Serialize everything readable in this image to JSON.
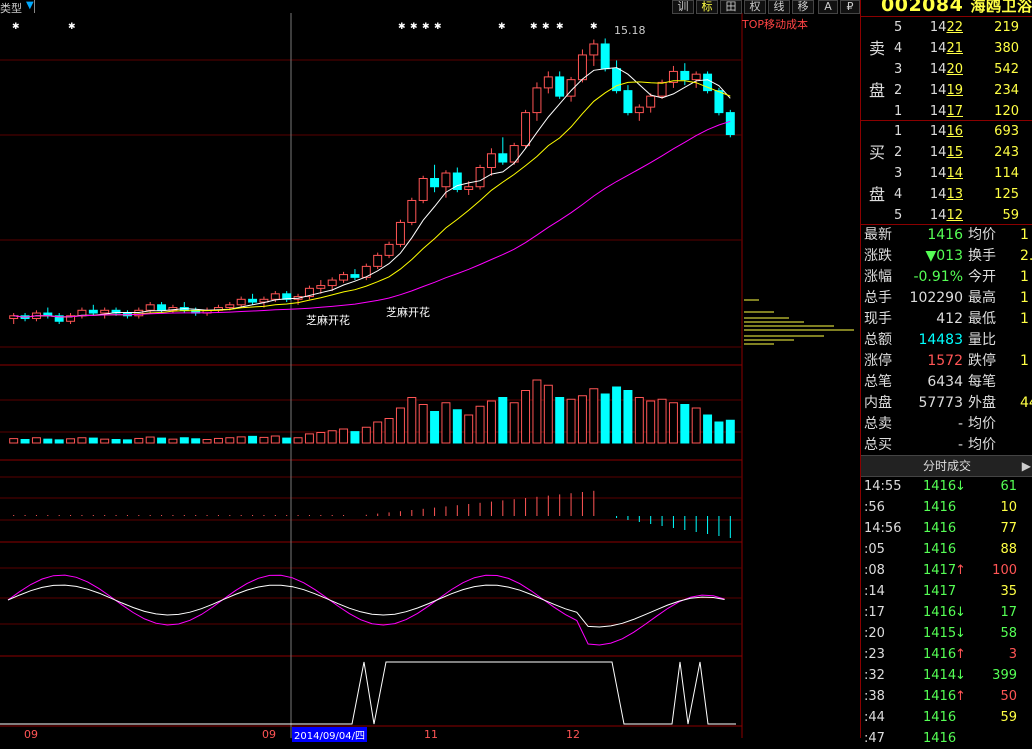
{
  "toolbar": {
    "left_label": "类型",
    "buttons": [
      "训",
      "标",
      "田",
      "权",
      "线",
      "移",
      "A",
      "₽",
      "▶"
    ]
  },
  "stock": {
    "code": "002084",
    "name": "海鸥卫浴"
  },
  "chart_annotations": {
    "peak_label": "15.18",
    "zhima_1": "芝麻开花",
    "zhima_2": "芝麻开花",
    "top_tool_label": "TOP移动成本"
  },
  "bottom_axis": {
    "left_tick": "09",
    "mid_tick": "09",
    "date_box": "2014/09/04/四",
    "tick_11": "11",
    "tick_12": "12"
  },
  "order_book": {
    "sell_label_1": "卖",
    "sell_label_2": "盘",
    "buy_label_1": "买",
    "buy_label_2": "盘",
    "sell": [
      {
        "level": "5",
        "price": "1422",
        "volume": "219"
      },
      {
        "level": "4",
        "price": "1421",
        "volume": "380"
      },
      {
        "level": "3",
        "price": "1420",
        "volume": "542"
      },
      {
        "level": "2",
        "price": "1419",
        "volume": "234"
      },
      {
        "level": "1",
        "price": "1417",
        "volume": "120"
      }
    ],
    "buy": [
      {
        "level": "1",
        "price": "1416",
        "volume": "693"
      },
      {
        "level": "2",
        "price": "1415",
        "volume": "243"
      },
      {
        "level": "3",
        "price": "1414",
        "volume": "114"
      },
      {
        "level": "4",
        "price": "1413",
        "volume": "125"
      },
      {
        "level": "5",
        "price": "1412",
        "volume": "59"
      }
    ]
  },
  "quote": [
    {
      "k1": "最新",
      "v1": "1416",
      "k2": "均价",
      "v2": "1"
    },
    {
      "k1": "涨跌",
      "v1": "▼013",
      "k2": "换手",
      "v2": "2."
    },
    {
      "k1": "涨幅",
      "v1": "-0.91%",
      "k2": "今开",
      "v2": "1"
    },
    {
      "k1": "总手",
      "v1": "102290",
      "k2": "最高",
      "v2": "1"
    },
    {
      "k1": "现手",
      "v1": "412",
      "k2": "最低",
      "v2": "1"
    },
    {
      "k1": "总额",
      "v1": "14483",
      "k2": "量比",
      "v2": ""
    },
    {
      "k1": "涨停",
      "v1": "1572",
      "k2": "跌停",
      "v2": "1"
    },
    {
      "k1": "总笔",
      "v1": "6434",
      "k2": "每笔",
      "v2": ""
    },
    {
      "k1": "内盘",
      "v1": "57773",
      "k2": "外盘",
      "v2": "44"
    },
    {
      "k1": "总卖",
      "v1": "-",
      "k2": "均价",
      "v2": ""
    },
    {
      "k1": "总买",
      "v1": "-",
      "k2": "均价",
      "v2": ""
    }
  ],
  "ticks_title": "分时成交",
  "ticks": [
    {
      "time": "14:55",
      "price": "1416",
      "arrow": "↓",
      "vol": "61"
    },
    {
      "time": ":56",
      "price": "1416",
      "arrow": "",
      "vol": "10"
    },
    {
      "time": "14:56",
      "price": "1416",
      "arrow": "",
      "vol": "77"
    },
    {
      "time": ":05",
      "price": "1416",
      "arrow": "",
      "vol": "88"
    },
    {
      "time": ":08",
      "price": "1417",
      "arrow": "↑",
      "vol": "100"
    },
    {
      "time": ":14",
      "price": "1417",
      "arrow": "",
      "vol": "35"
    },
    {
      "time": ":17",
      "price": "1416",
      "arrow": "↓",
      "vol": "17"
    },
    {
      "time": ":20",
      "price": "1415",
      "arrow": "↓",
      "vol": "58"
    },
    {
      "time": ":23",
      "price": "1416",
      "arrow": "↑",
      "vol": "3"
    },
    {
      "time": ":32",
      "price": "1414",
      "arrow": "↓",
      "vol": "399"
    },
    {
      "time": ":38",
      "price": "1416",
      "arrow": "↑",
      "vol": "50"
    },
    {
      "time": ":44",
      "price": "1416",
      "arrow": "",
      "vol": "59"
    },
    {
      "time": ":47",
      "price": "1416",
      "arrow": "",
      "vol": ""
    }
  ],
  "chart_data": {
    "type": "candlestick",
    "candles": [
      [
        10.1,
        10.2,
        10.0,
        10.15
      ],
      [
        10.15,
        10.2,
        10.05,
        10.1
      ],
      [
        10.1,
        10.25,
        10.05,
        10.2
      ],
      [
        10.2,
        10.3,
        10.1,
        10.15
      ],
      [
        10.15,
        10.2,
        10.0,
        10.05
      ],
      [
        10.05,
        10.2,
        10.0,
        10.15
      ],
      [
        10.15,
        10.3,
        10.1,
        10.25
      ],
      [
        10.25,
        10.35,
        10.15,
        10.2
      ],
      [
        10.2,
        10.3,
        10.1,
        10.25
      ],
      [
        10.25,
        10.3,
        10.15,
        10.2
      ],
      [
        10.2,
        10.25,
        10.1,
        10.15
      ],
      [
        10.15,
        10.3,
        10.1,
        10.25
      ],
      [
        10.25,
        10.4,
        10.2,
        10.35
      ],
      [
        10.35,
        10.4,
        10.2,
        10.25
      ],
      [
        10.25,
        10.35,
        10.2,
        10.3
      ],
      [
        10.3,
        10.4,
        10.2,
        10.25
      ],
      [
        10.25,
        10.3,
        10.15,
        10.2
      ],
      [
        10.2,
        10.3,
        10.15,
        10.25
      ],
      [
        10.25,
        10.35,
        10.2,
        10.3
      ],
      [
        10.3,
        10.4,
        10.25,
        10.35
      ],
      [
        10.35,
        10.5,
        10.3,
        10.45
      ],
      [
        10.45,
        10.55,
        10.35,
        10.4
      ],
      [
        10.4,
        10.5,
        10.3,
        10.45
      ],
      [
        10.45,
        10.6,
        10.4,
        10.55
      ],
      [
        10.55,
        10.6,
        10.4,
        10.45
      ],
      [
        10.45,
        10.55,
        10.35,
        10.5
      ],
      [
        10.5,
        10.7,
        10.45,
        10.65
      ],
      [
        10.65,
        10.8,
        10.55,
        10.7
      ],
      [
        10.7,
        10.85,
        10.6,
        10.8
      ],
      [
        10.8,
        10.95,
        10.75,
        10.9
      ],
      [
        10.9,
        11.0,
        10.8,
        10.85
      ],
      [
        10.85,
        11.1,
        10.8,
        11.05
      ],
      [
        11.05,
        11.3,
        11.0,
        11.25
      ],
      [
        11.25,
        11.5,
        11.2,
        11.45
      ],
      [
        11.45,
        11.9,
        11.4,
        11.85
      ],
      [
        11.85,
        12.3,
        11.8,
        12.25
      ],
      [
        12.25,
        12.7,
        12.2,
        12.65
      ],
      [
        12.65,
        12.9,
        12.4,
        12.5
      ],
      [
        12.5,
        12.8,
        12.3,
        12.75
      ],
      [
        12.75,
        12.85,
        12.4,
        12.45
      ],
      [
        12.45,
        12.6,
        12.35,
        12.5
      ],
      [
        12.5,
        12.9,
        12.45,
        12.85
      ],
      [
        12.85,
        13.2,
        12.7,
        13.1
      ],
      [
        13.1,
        13.4,
        12.9,
        12.95
      ],
      [
        12.95,
        13.3,
        12.9,
        13.25
      ],
      [
        13.25,
        13.9,
        13.2,
        13.85
      ],
      [
        13.85,
        14.4,
        13.7,
        14.3
      ],
      [
        14.3,
        14.6,
        14.2,
        14.5
      ],
      [
        14.5,
        14.6,
        14.1,
        14.15
      ],
      [
        14.15,
        14.5,
        14.05,
        14.45
      ],
      [
        14.45,
        15.0,
        14.4,
        14.9
      ],
      [
        14.9,
        15.18,
        14.7,
        15.1
      ],
      [
        15.1,
        15.2,
        14.6,
        14.65
      ],
      [
        14.65,
        14.8,
        14.2,
        14.25
      ],
      [
        14.25,
        14.35,
        13.8,
        13.85
      ],
      [
        13.85,
        14.0,
        13.7,
        13.95
      ],
      [
        13.95,
        14.2,
        13.85,
        14.15
      ],
      [
        14.15,
        14.45,
        14.1,
        14.4
      ],
      [
        14.4,
        14.7,
        14.3,
        14.6
      ],
      [
        14.6,
        14.75,
        14.35,
        14.45
      ],
      [
        14.45,
        14.6,
        14.3,
        14.55
      ],
      [
        14.55,
        14.6,
        14.2,
        14.25
      ],
      [
        14.25,
        14.3,
        13.8,
        13.85
      ],
      [
        13.85,
        13.9,
        13.4,
        13.45
      ]
    ],
    "volume": [
      25,
      20,
      30,
      22,
      18,
      24,
      30,
      28,
      22,
      20,
      18,
      26,
      34,
      28,
      22,
      30,
      24,
      20,
      26,
      30,
      35,
      38,
      32,
      40,
      28,
      30,
      52,
      60,
      70,
      80,
      65,
      90,
      120,
      140,
      200,
      260,
      220,
      180,
      230,
      190,
      160,
      210,
      240,
      260,
      230,
      300,
      360,
      330,
      260,
      250,
      270,
      310,
      280,
      320,
      300,
      260,
      240,
      250,
      230,
      220,
      200,
      160,
      120,
      130
    ],
    "ylim": [
      9.8,
      15.5
    ]
  }
}
